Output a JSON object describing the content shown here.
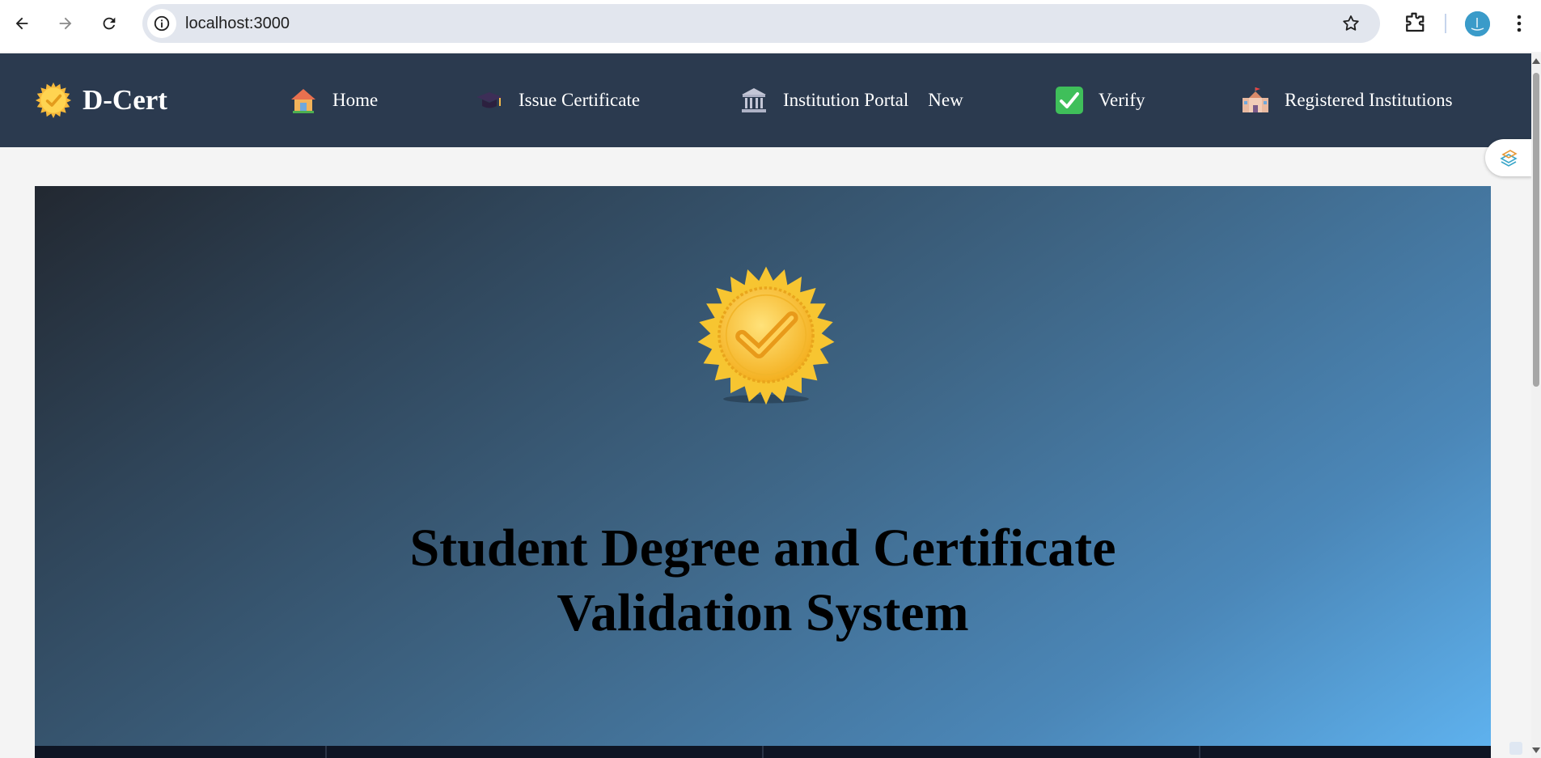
{
  "browser": {
    "url": "localhost:3000",
    "back_icon": "arrow-left-icon",
    "forward_icon": "arrow-right-icon",
    "reload_icon": "reload-icon",
    "site_info_icon": "info-icon",
    "bookmark_icon": "star-icon",
    "extensions_icon": "puzzle-icon",
    "menu_icon": "kebab-icon"
  },
  "navbar": {
    "brand": {
      "icon": "seal-badge-icon",
      "label": "D-Cert"
    },
    "items": [
      {
        "icon": "house-icon",
        "label": "Home"
      },
      {
        "icon": "graduation-cap-icon",
        "label": "Issue Certificate"
      },
      {
        "icon": "bank-building-icon",
        "label": "Institution Portal",
        "badge": "New"
      },
      {
        "icon": "check-box-icon",
        "label": "Verify"
      },
      {
        "icon": "school-icon",
        "label": "Registered Institutions"
      }
    ]
  },
  "hero": {
    "icon": "seal-badge-icon",
    "title_line1": "Student Degree and Certificate",
    "title_line2": "Validation System"
  },
  "colors": {
    "navbar_bg": "#2b3a4f",
    "hero_gradient_start": "#222831",
    "hero_gradient_end": "#5fb3f0",
    "seal_gold": "#f7c531"
  }
}
